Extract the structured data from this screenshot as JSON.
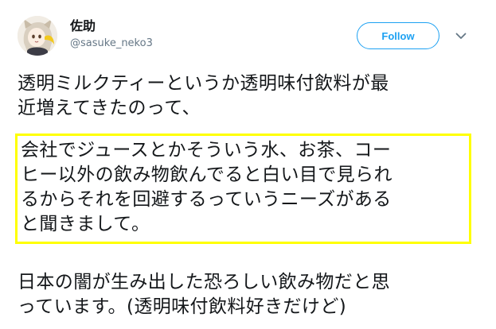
{
  "user": {
    "display_name": "佐助",
    "handle": "@sasuke_neko3"
  },
  "follow_label": "Follow",
  "icons": {
    "avatar": "cat-girl-avatar",
    "more": "chevron-down-icon"
  },
  "colors": {
    "accent": "#1da1f2",
    "highlight_border": "#ffff00",
    "text": "#14171a",
    "secondary_text": "#657786"
  },
  "tweet": {
    "paragraph_1": [
      "透明ミルクティーというか透明味付飲料が最",
      "近増えてきたのって、"
    ],
    "paragraph_2": [
      "会社でジュースとかそういう水、お茶、コー",
      "ヒー以外の飲み物飲んでると白い目で見られ",
      "るからそれを回避するっていうニーズがある",
      "と聞きまして。"
    ],
    "paragraph_3": [
      "日本の闇が生み出した恐ろしい飲み物だと思",
      "っています。(透明味付飲料好きだけど)"
    ]
  }
}
